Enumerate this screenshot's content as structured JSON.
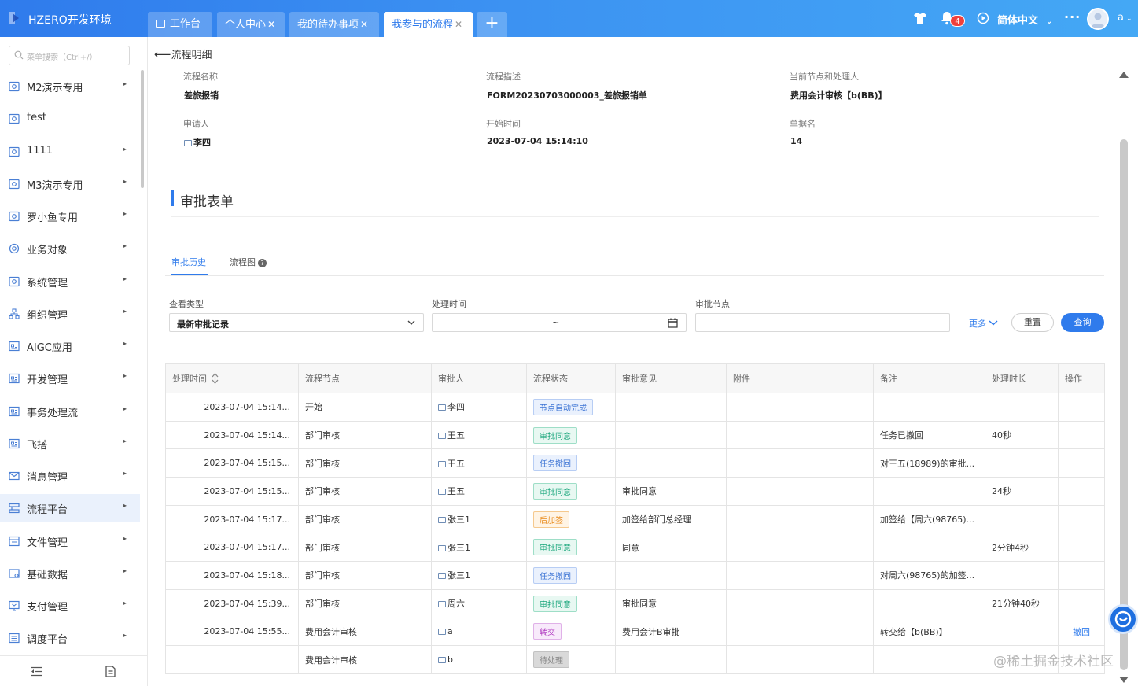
{
  "app_title": "HZERO开发环境",
  "tabs": [
    {
      "label": "工作台",
      "closable": false,
      "active": false
    },
    {
      "label": "个人中心",
      "closable": true,
      "active": false
    },
    {
      "label": "我的待办事项",
      "closable": true,
      "active": false
    },
    {
      "label": "我参与的流程",
      "closable": true,
      "active": true
    }
  ],
  "header": {
    "notification_count": "4",
    "language": "简体中文",
    "user": "a"
  },
  "sidebar": {
    "search_placeholder": "菜单搜索（Ctrl+/）",
    "items": [
      {
        "label": "M2演示专用",
        "icon": "module-icon",
        "arrow": true
      },
      {
        "label": "test",
        "icon": "module-icon",
        "arrow": false
      },
      {
        "label": "1111",
        "icon": "module-icon",
        "arrow": true
      },
      {
        "label": "M3演示专用",
        "icon": "module-icon",
        "arrow": true
      },
      {
        "label": "罗小鱼专用",
        "icon": "module-icon",
        "arrow": true
      },
      {
        "label": "业务对象",
        "icon": "target-icon",
        "arrow": true
      },
      {
        "label": "系统管理",
        "icon": "module-icon",
        "arrow": true
      },
      {
        "label": "组织管理",
        "icon": "org-icon",
        "arrow": true
      },
      {
        "label": "AIGC应用",
        "icon": "app-icon",
        "arrow": true
      },
      {
        "label": "开发管理",
        "icon": "app-icon",
        "arrow": true
      },
      {
        "label": "事务处理流",
        "icon": "app-icon",
        "arrow": true
      },
      {
        "label": "飞搭",
        "icon": "app-icon",
        "arrow": true
      },
      {
        "label": "消息管理",
        "icon": "mail-icon",
        "arrow": true
      },
      {
        "label": "流程平台",
        "icon": "flow-icon",
        "arrow": true,
        "active": true
      },
      {
        "label": "文件管理",
        "icon": "file-icon",
        "arrow": true
      },
      {
        "label": "基础数据",
        "icon": "data-icon",
        "arrow": true
      },
      {
        "label": "支付管理",
        "icon": "pay-icon",
        "arrow": true
      },
      {
        "label": "调度平台",
        "icon": "schedule-icon",
        "arrow": true
      }
    ]
  },
  "page": {
    "back_label": "流程明细"
  },
  "info": {
    "flow_name_label": "流程名称",
    "flow_name": "差旅报销",
    "flow_desc_label": "流程描述",
    "flow_desc": "FORM20230703000003_差旅报销单",
    "current_node_label": "当前节点和处理人",
    "current_node": "费用会计审核【b(BB)】",
    "applicant_label": "申请人",
    "applicant": "李四",
    "start_time_label": "开始时间",
    "start_time": "2023-07-04 15:14:10",
    "doc_name_label": "单据名",
    "doc_name": "14"
  },
  "section": {
    "title": "审批表单"
  },
  "sub_tabs": {
    "history": "审批历史",
    "diagram": "流程图"
  },
  "filters": {
    "view_type_label": "查看类型",
    "view_type_value": "最新审批记录",
    "time_label": "处理时间",
    "time_sep": "~",
    "node_label": "审批节点",
    "more": "更多",
    "reset": "重置",
    "query": "查询"
  },
  "table": {
    "headers": [
      "处理时间",
      "流程节点",
      "审批人",
      "流程状态",
      "审批意见",
      "附件",
      "备注",
      "处理时长",
      "操作"
    ],
    "rows": [
      {
        "time": "2023-07-04 15:14...",
        "node": "开始",
        "approver": "李四",
        "status": "节点自动完成",
        "status_type": "blue",
        "opinion": "",
        "attachment": "",
        "remark": "",
        "duration": "",
        "action": ""
      },
      {
        "time": "2023-07-04 15:14...",
        "node": "部门审核",
        "approver": "王五",
        "status": "审批同意",
        "status_type": "green",
        "opinion": "",
        "attachment": "",
        "remark": "任务已撤回",
        "duration": "40秒",
        "action": ""
      },
      {
        "time": "2023-07-04 15:15...",
        "node": "部门审核",
        "approver": "王五",
        "status": "任务撤回",
        "status_type": "blue",
        "opinion": "",
        "attachment": "",
        "remark": "对王五(18989)的审批...",
        "duration": "",
        "action": ""
      },
      {
        "time": "2023-07-04 15:15...",
        "node": "部门审核",
        "approver": "王五",
        "status": "审批同意",
        "status_type": "green",
        "opinion": "审批同意",
        "attachment": "",
        "remark": "",
        "duration": "24秒",
        "action": ""
      },
      {
        "time": "2023-07-04 15:17...",
        "node": "部门审核",
        "approver": "张三1",
        "status": "后加签",
        "status_type": "orange",
        "opinion": "加签给部门总经理",
        "attachment": "",
        "remark": "加签给【周六(98765)...",
        "duration": "",
        "action": ""
      },
      {
        "time": "2023-07-04 15:17...",
        "node": "部门审核",
        "approver": "张三1",
        "status": "审批同意",
        "status_type": "green",
        "opinion": "同意",
        "attachment": "",
        "remark": "",
        "duration": "2分钟4秒",
        "action": ""
      },
      {
        "time": "2023-07-04 15:18...",
        "node": "部门审核",
        "approver": "张三1",
        "status": "任务撤回",
        "status_type": "blue",
        "opinion": "",
        "attachment": "",
        "remark": "对周六(98765)的加签...",
        "duration": "",
        "action": ""
      },
      {
        "time": "2023-07-04 15:39...",
        "node": "部门审核",
        "approver": "周六",
        "status": "审批同意",
        "status_type": "green",
        "opinion": "审批同意",
        "attachment": "",
        "remark": "",
        "duration": "21分钟40秒",
        "action": ""
      },
      {
        "time": "2023-07-04 15:55...",
        "node": "费用会计审核",
        "approver": "a",
        "status": "转交",
        "status_type": "purple",
        "opinion": "费用会计B审批",
        "attachment": "",
        "remark": "转交给【b(BB)】",
        "duration": "",
        "action": "撤回"
      },
      {
        "time": "",
        "node": "费用会计审核",
        "approver": "b",
        "status": "待处理",
        "status_type": "gray",
        "opinion": "",
        "attachment": "",
        "remark": "",
        "duration": "",
        "action": ""
      }
    ]
  },
  "watermark": "@稀土掘金技术社区",
  "colors": {
    "primary": "#2f7bec",
    "topbar_start": "#2f7bec",
    "topbar_end": "#44a8f5"
  }
}
